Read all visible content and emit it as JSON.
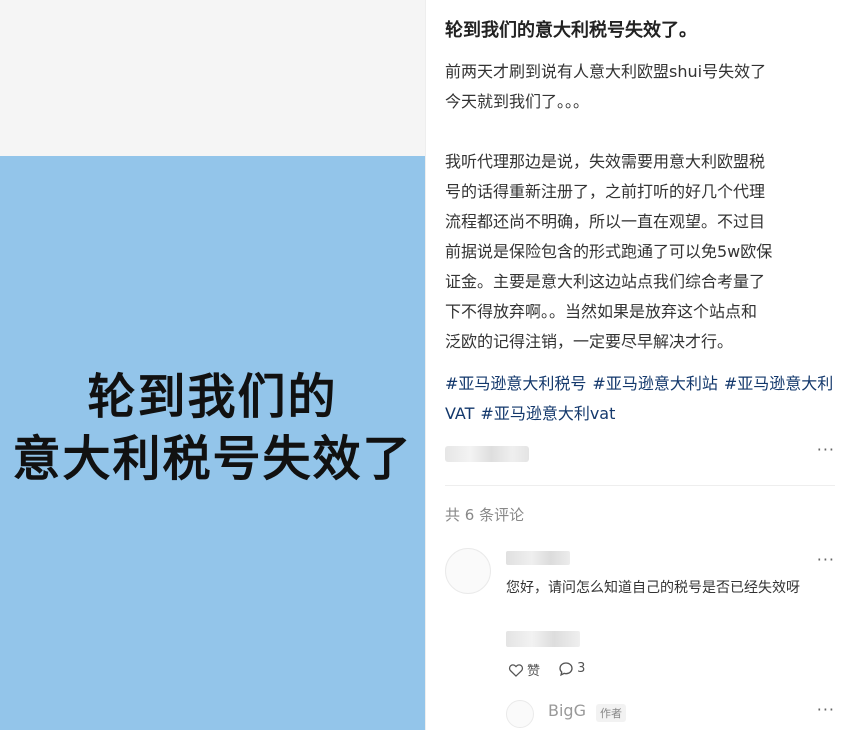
{
  "image": {
    "headline_line1": "轮到我们的",
    "headline_line2": "意大利税号失效了",
    "background_color": "#93c5ea"
  },
  "post": {
    "title": "轮到我们的意大利税号失效了。",
    "paragraph1": "前两天才刷到说有人意大利欧盟shui号失效了\n今天就到我们了。。。",
    "paragraph2": "我听代理那边是说，失效需要用意大利欧盟税\n号的话得重新注册了，之前打听的好几个代理\n流程都还尚不明确，所以一直在观望。不过目\n前据说是保险包含的形式跑通了可以免5w欧保\n证金。主要是意大利这边站点我们综合考量了\n下不得放弃啊。。当然如果是放弃这个站点和\n泛欧的记得注销，一定要尽早解决才行。",
    "tags": [
      "#亚马逊意大利税号",
      "#亚马逊意大利站",
      "#亚马逊意大利VAT",
      "#亚马逊意大利vat"
    ],
    "tag_color": "#13386c",
    "more_label": "···"
  },
  "comments": {
    "count_label": "共 6 条评论",
    "items": [
      {
        "text": "您好，请问怎么知道自己的税号是否已经失效呀",
        "like_label": "赞",
        "reply_count": "3",
        "more_label": "···"
      },
      {
        "name": "BigG",
        "badge": "作者",
        "more_label": "···"
      }
    ]
  }
}
